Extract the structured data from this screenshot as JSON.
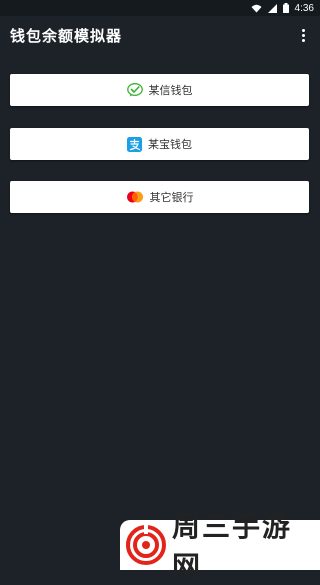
{
  "status_bar": {
    "time": "4:36",
    "icons": [
      "wifi-icon",
      "signal-icon",
      "battery-icon"
    ]
  },
  "app_bar": {
    "title": "钱包余额模拟器",
    "menu_icon": "more-vert-icon"
  },
  "wallets": [
    {
      "label": "某信钱包",
      "icon": "wechat-pay-icon",
      "icon_color": "#3cb034"
    },
    {
      "label": "某宝钱包",
      "icon": "alipay-icon",
      "icon_color": "#1aa0e6"
    },
    {
      "label": "其它银行",
      "icon": "mastercard-icon",
      "icon_color": "#eb001b"
    }
  ],
  "watermark": {
    "text": "周三手游网",
    "logo_color": "#e2241a"
  },
  "colors": {
    "background": "#1c2228",
    "button": "#ffffff",
    "button_text": "#333333"
  }
}
